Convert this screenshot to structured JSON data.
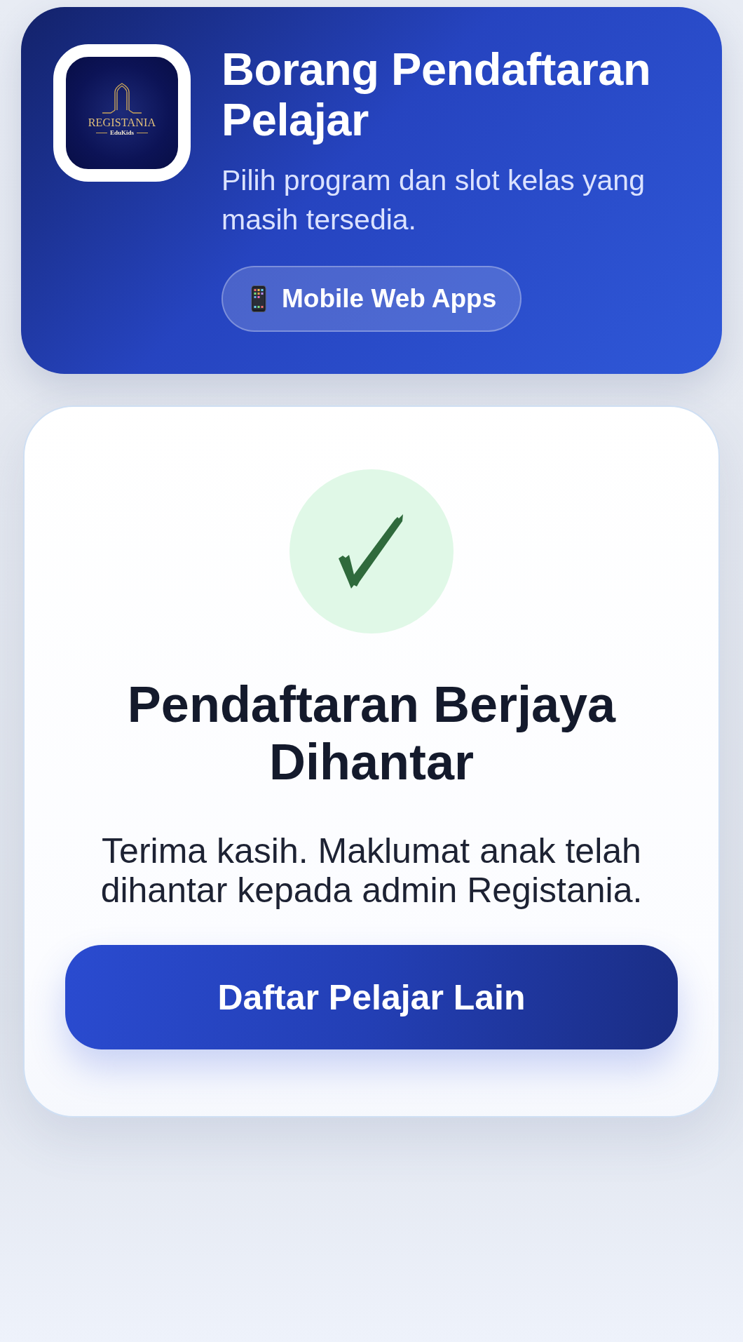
{
  "header": {
    "logo": {
      "wordmark": "REGISTANIA",
      "tagline": "EduKids"
    },
    "title": "Borang Pendaftaran Pelajar",
    "subtitle": "Pilih program dan slot kelas yang masih tersedia.",
    "badge": {
      "label": "Mobile Web Apps"
    }
  },
  "result": {
    "title": "Pendaftaran Berjaya Dihantar",
    "message": "Terima kasih. Maklumat anak telah dihantar kepada admin Registania.",
    "button": "Daftar Pelajar Lain"
  }
}
